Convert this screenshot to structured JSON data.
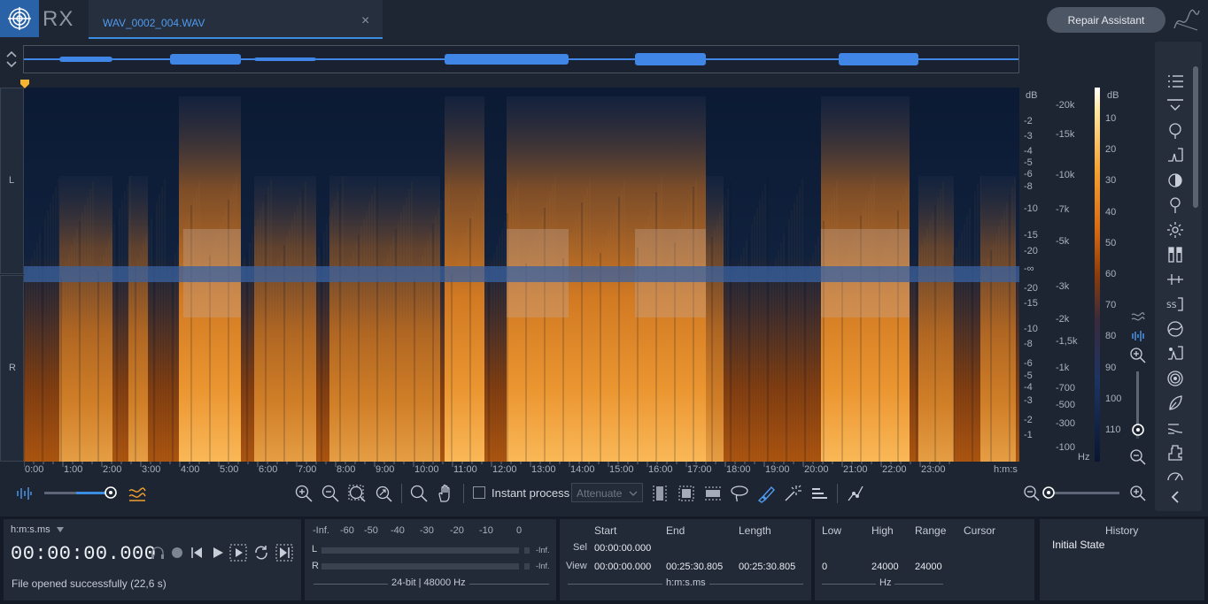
{
  "app": {
    "name": "RX"
  },
  "tab": {
    "filename": "WAV_0002_004.WAV",
    "close": "×"
  },
  "header": {
    "repair_assistant": "Repair Assistant"
  },
  "channels": {
    "left": "L",
    "right": "R"
  },
  "db_scale": {
    "unit": "dB",
    "ticks": [
      "-2",
      "-3",
      "-4",
      "-5",
      "-6",
      "-8",
      "-10",
      "-15",
      "-20",
      "-∞",
      "-20",
      "-15",
      "-10",
      "-8",
      "-6",
      "-5",
      "-4",
      "-3",
      "-2",
      "-1"
    ]
  },
  "hz_scale": {
    "unit": "Hz",
    "ticks": [
      "-20k",
      "-15k",
      "-10k",
      "-7k",
      "-5k",
      "-3k",
      "-2k",
      "-1,5k",
      "-1k",
      "-700",
      "-500",
      "-300",
      "-100"
    ]
  },
  "colorbar": {
    "unit": "dB",
    "ticks": [
      "10",
      "20",
      "30",
      "40",
      "50",
      "60",
      "70",
      "80",
      "90",
      "100",
      "110"
    ]
  },
  "timeline": {
    "ticks": [
      "0:00",
      "1:00",
      "2:00",
      "3:00",
      "4:00",
      "5:00",
      "6:00",
      "7:00",
      "8:00",
      "9:00",
      "10:00",
      "11:00",
      "12:00",
      "13:00",
      "14:00",
      "15:00",
      "16:00",
      "17:00",
      "18:00",
      "19:00",
      "20:00",
      "21:00",
      "22:00",
      "23:00"
    ],
    "unit": "h:m:s"
  },
  "toolbar": {
    "instant_process": "Instant process",
    "mode": "Attenuate"
  },
  "transport": {
    "format_label": "h:m:s.ms",
    "time": "00:00:00.000",
    "status": "File opened successfully (22,6 s)"
  },
  "meter": {
    "scale": [
      "-Inf.",
      "-60",
      "-50",
      "-40",
      "-30",
      "-20",
      "-10",
      "0"
    ],
    "l": "L",
    "r": "R",
    "l_val": "-Inf.",
    "r_val": "-Inf.",
    "format": "24-bit | 48000 Hz"
  },
  "selection": {
    "headers": {
      "start": "Start",
      "end": "End",
      "length": "Length"
    },
    "sel_label": "Sel",
    "view_label": "View",
    "sel_start": "00:00:00.000",
    "view_start": "00:00:00.000",
    "view_end": "00:25:30.805",
    "view_length": "00:25:30.805",
    "unit": "h:m:s.ms"
  },
  "freq": {
    "headers": {
      "low": "Low",
      "high": "High",
      "range": "Range",
      "cursor": "Cursor"
    },
    "low": "0",
    "high": "24000",
    "range": "24000",
    "unit": "Hz"
  },
  "history": {
    "title": "History",
    "item": "Initial State"
  },
  "colors": {
    "accent": "#3a8de0",
    "panel": "#222a37",
    "waveform": "#3f86e6"
  }
}
